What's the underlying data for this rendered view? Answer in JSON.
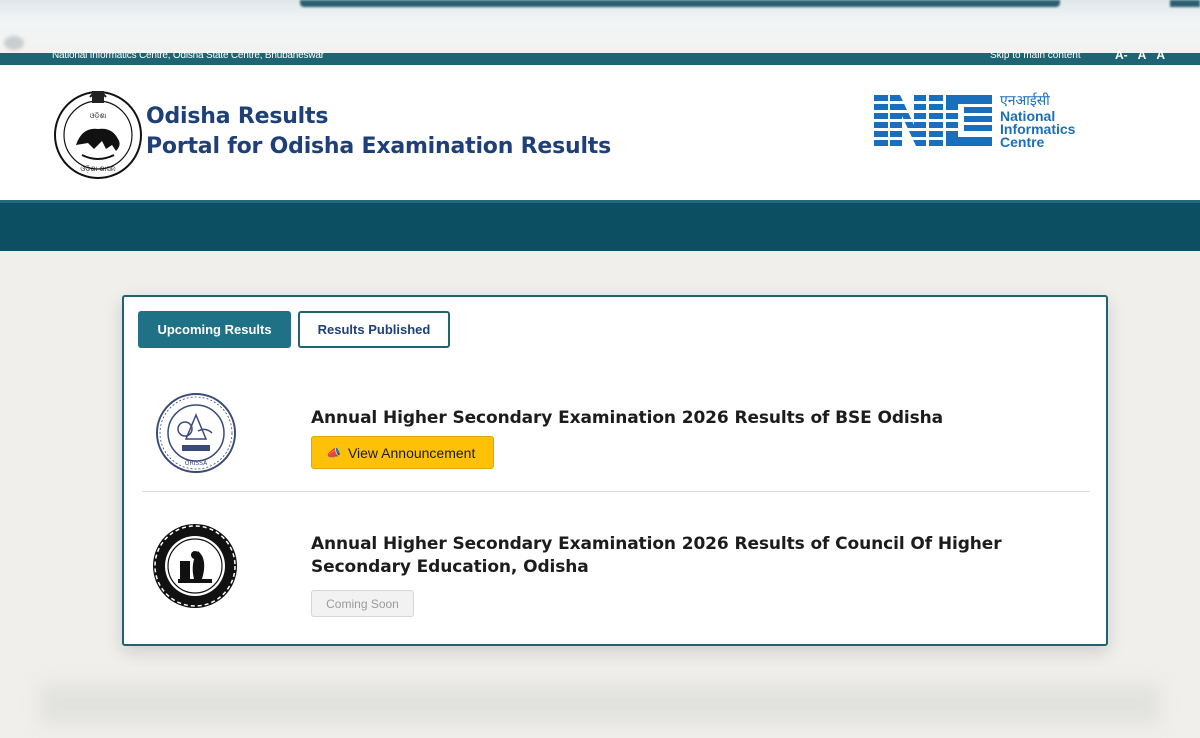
{
  "topbar": {
    "org_text": "National Informatics Centre, Odisha State Centre, Bhubaneswar",
    "skip_link": "Skip to main content",
    "font_small": "A-",
    "font_normal": "A",
    "font_large": "A"
  },
  "header": {
    "title_line1": "Odisha Results",
    "title_line2": "Portal for Odisha Examination Results",
    "nic": {
      "hindi": "एनआईसी",
      "line1": "National",
      "line2": "Informatics",
      "line3": "Centre"
    }
  },
  "tabs": [
    {
      "label": "Upcoming Results",
      "active": true
    },
    {
      "label": "Results Published",
      "active": false
    }
  ],
  "results": [
    {
      "title": "Annual Higher Secondary Examination 2026 Results of BSE Odisha",
      "button_label": "View Announcement",
      "button_icon": "megaphone-icon",
      "status": "active"
    },
    {
      "title": "Annual Higher Secondary Examination 2026 Results of Council Of Higher Secondary Education, Odisha",
      "button_label": "Coming Soon",
      "status": "disabled"
    }
  ],
  "colors": {
    "brand_teal": "#1f6473",
    "nav_dark": "#0d4f62",
    "title_blue": "#1e3f78",
    "nic_blue": "#1a6fbc",
    "announce_yellow": "#ffc107"
  }
}
